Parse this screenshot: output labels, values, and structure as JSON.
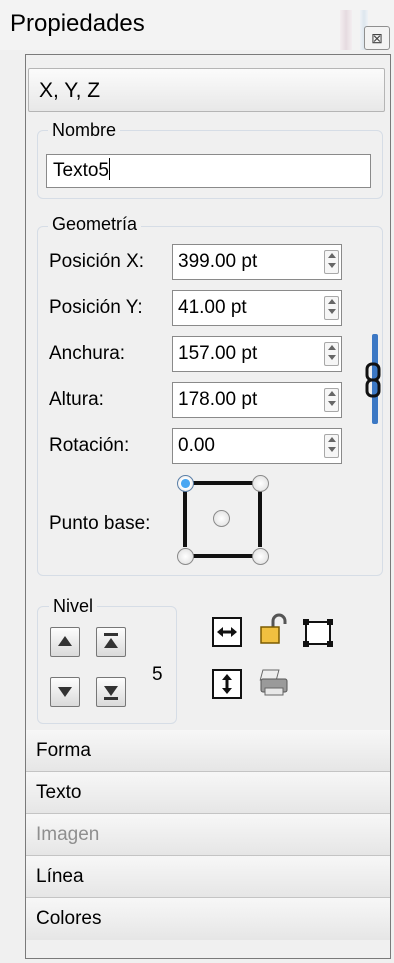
{
  "panel": {
    "title": "Propiedades",
    "close_glyph": "⊠"
  },
  "xyz_header": "X, Y, Z",
  "nombre": {
    "label": "Nombre",
    "value": "Texto5"
  },
  "geometria": {
    "label": "Geometría",
    "fields": [
      {
        "label": "Posición X:",
        "value": "399.00 pt"
      },
      {
        "label": "Posición Y:",
        "value": "41.00 pt"
      },
      {
        "label": "Anchura:",
        "value": "157.00 pt"
      },
      {
        "label": "Altura:",
        "value": "178.00 pt"
      },
      {
        "label": "Rotación:",
        "value": "0.00"
      }
    ],
    "basepoint_label": "Punto base:",
    "basepoint_selected": "top-left"
  },
  "nivel": {
    "label": "Nivel",
    "value": "5"
  },
  "sections": [
    "Forma",
    "Texto",
    "Imagen",
    "Línea",
    "Colores"
  ],
  "disabled_sections": [
    "Imagen"
  ],
  "icons": {
    "level": [
      "arrow-up-icon",
      "arrow-top-icon",
      "arrow-down-icon",
      "arrow-bottom-icon"
    ],
    "tools": [
      "flip-horizontal-icon",
      "lock-icon",
      "resize-frame-icon",
      "flip-vertical-icon",
      "print-icon"
    ],
    "link": "chain-link-icon"
  },
  "colors": {
    "accent": "#3c78c4",
    "selected_radio": "#4aa7f2",
    "disabled_text": "#8f8f8f"
  }
}
